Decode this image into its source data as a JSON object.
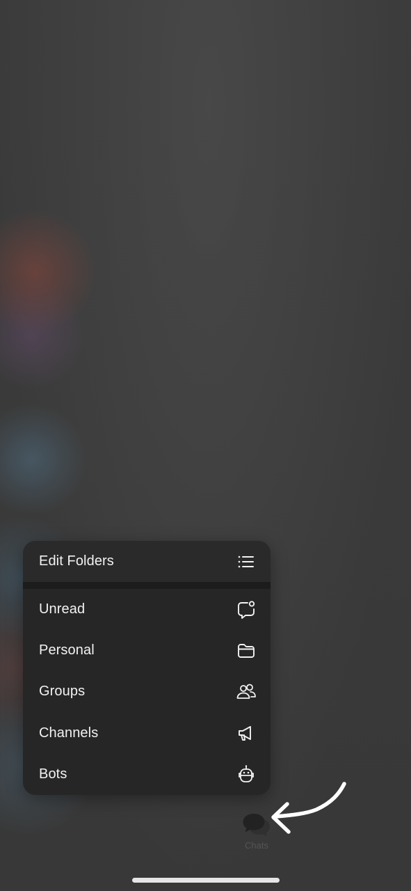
{
  "menu": {
    "header": {
      "label": "Edit Folders",
      "icon": "list-icon"
    },
    "items": [
      {
        "label": "Unread",
        "icon": "unread-chat-icon"
      },
      {
        "label": "Personal",
        "icon": "folder-icon"
      },
      {
        "label": "Groups",
        "icon": "people-icon"
      },
      {
        "label": "Channels",
        "icon": "megaphone-icon"
      },
      {
        "label": "Bots",
        "icon": "robot-icon"
      }
    ]
  },
  "tabbar": {
    "chats": {
      "label": "Chats",
      "icon": "chat-bubbles-icon"
    }
  },
  "annotation": {
    "icon": "hand-drawn-arrow-icon"
  },
  "colors": {
    "menu_background": "#262626",
    "menu_text": "#f2f2f2",
    "tab_inactive": "#555555",
    "annotation": "#ffffff"
  }
}
